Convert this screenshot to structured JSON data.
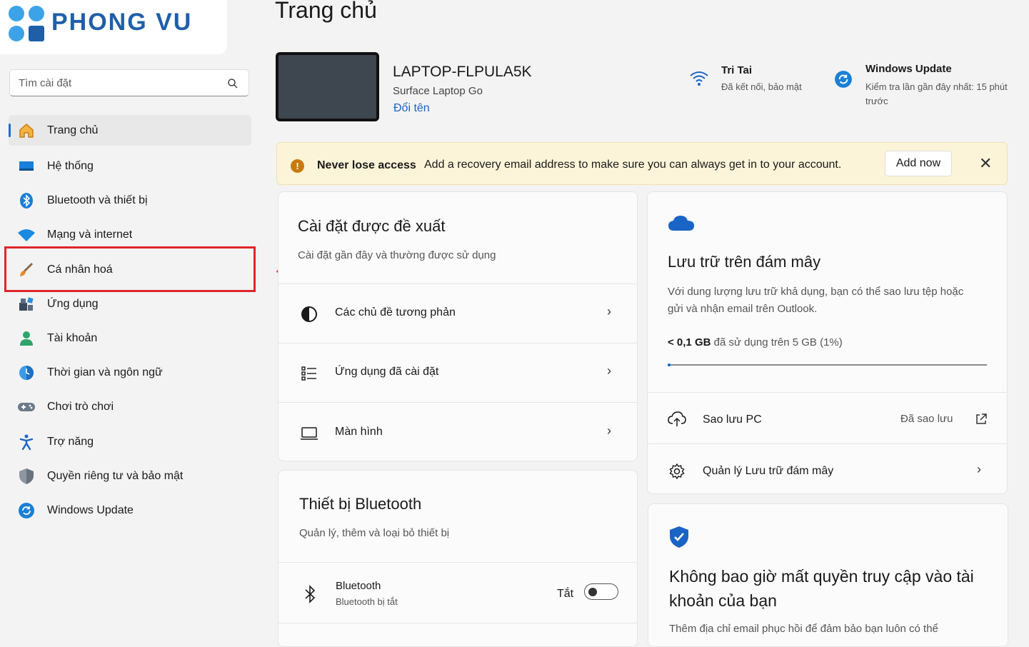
{
  "brand": {
    "name": "PHONG VU"
  },
  "search": {
    "placeholder": "Tìm cài đặt"
  },
  "sidebar": {
    "items": [
      {
        "label": "Trang chủ",
        "icon": "home-icon",
        "active": true
      },
      {
        "label": "Hệ thống",
        "icon": "system-icon"
      },
      {
        "label": "Bluetooth và thiết bị",
        "icon": "bluetooth-icon"
      },
      {
        "label": "Mạng và internet",
        "icon": "wifi-icon"
      },
      {
        "label": "Cá nhân hoá",
        "icon": "paintbrush-icon"
      },
      {
        "label": "Ứng dụng",
        "icon": "apps-icon"
      },
      {
        "label": "Tài khoản",
        "icon": "account-icon"
      },
      {
        "label": "Thời gian và ngôn ngữ",
        "icon": "globe-clock-icon"
      },
      {
        "label": "Chơi trò chơi",
        "icon": "gamepad-icon"
      },
      {
        "label": "Trợ năng",
        "icon": "accessibility-icon"
      },
      {
        "label": "Quyền riêng tư và bảo mật",
        "icon": "shield-icon"
      },
      {
        "label": "Windows Update",
        "icon": "update-icon"
      }
    ]
  },
  "header": {
    "title": "Trang chủ"
  },
  "device": {
    "name": "LAPTOP-FLPULA5K",
    "model": "Surface Laptop Go",
    "rename": "Đổi tên"
  },
  "status": {
    "network": {
      "title": "Tri Tai",
      "subtitle": "Đã kết nối, bảo mật"
    },
    "update": {
      "title": "Windows Update",
      "subtitle": "Kiểm tra lần gần đây nhất: 15 phút trước"
    }
  },
  "banner": {
    "title": "Never lose access",
    "message": "Add a recovery email address to make sure you can always get in to your account.",
    "button": "Add now"
  },
  "recommended": {
    "title": "Cài đặt được đề xuất",
    "subtitle": "Cài đặt gần đây và thường được sử dụng",
    "items": [
      {
        "label": "Các chủ đề tương phản",
        "icon": "contrast-icon"
      },
      {
        "label": "Ứng dụng đã cài đặt",
        "icon": "list-icon"
      },
      {
        "label": "Màn hình",
        "icon": "display-icon"
      }
    ]
  },
  "bluetooth": {
    "title": "Thiết bị Bluetooth",
    "subtitle": "Quản lý, thêm và loại bỏ thiết bị",
    "device_label": "Bluetooth",
    "device_status": "Bluetooth bị tắt",
    "toggle_label": "Tắt",
    "toggle_on": false
  },
  "cloud": {
    "title": "Lưu trữ trên đám mây",
    "description": "Với dung lượng lưu trữ khả dụng, bạn có thể sao lưu tệp hoặc gửi và nhận email trên Outlook.",
    "used": "< 0,1 GB",
    "usage_text": "đã sử dụng trên 5 GB (1%)",
    "usage_fraction": 0.01,
    "backup_label": "Sao lưu PC",
    "backup_status": "Đã sao lưu",
    "manage_label": "Quản lý Lưu trữ đám mây"
  },
  "account": {
    "title": "Không bao giờ mất quyền truy cập vào tài khoản của bạn",
    "description": "Thêm địa chỉ email phục hồi để đảm bảo bạn luôn có thể"
  },
  "colors": {
    "accent": "#1a64c6",
    "highlight": "#e0252b",
    "banner_bg": "#fcf4d8"
  }
}
